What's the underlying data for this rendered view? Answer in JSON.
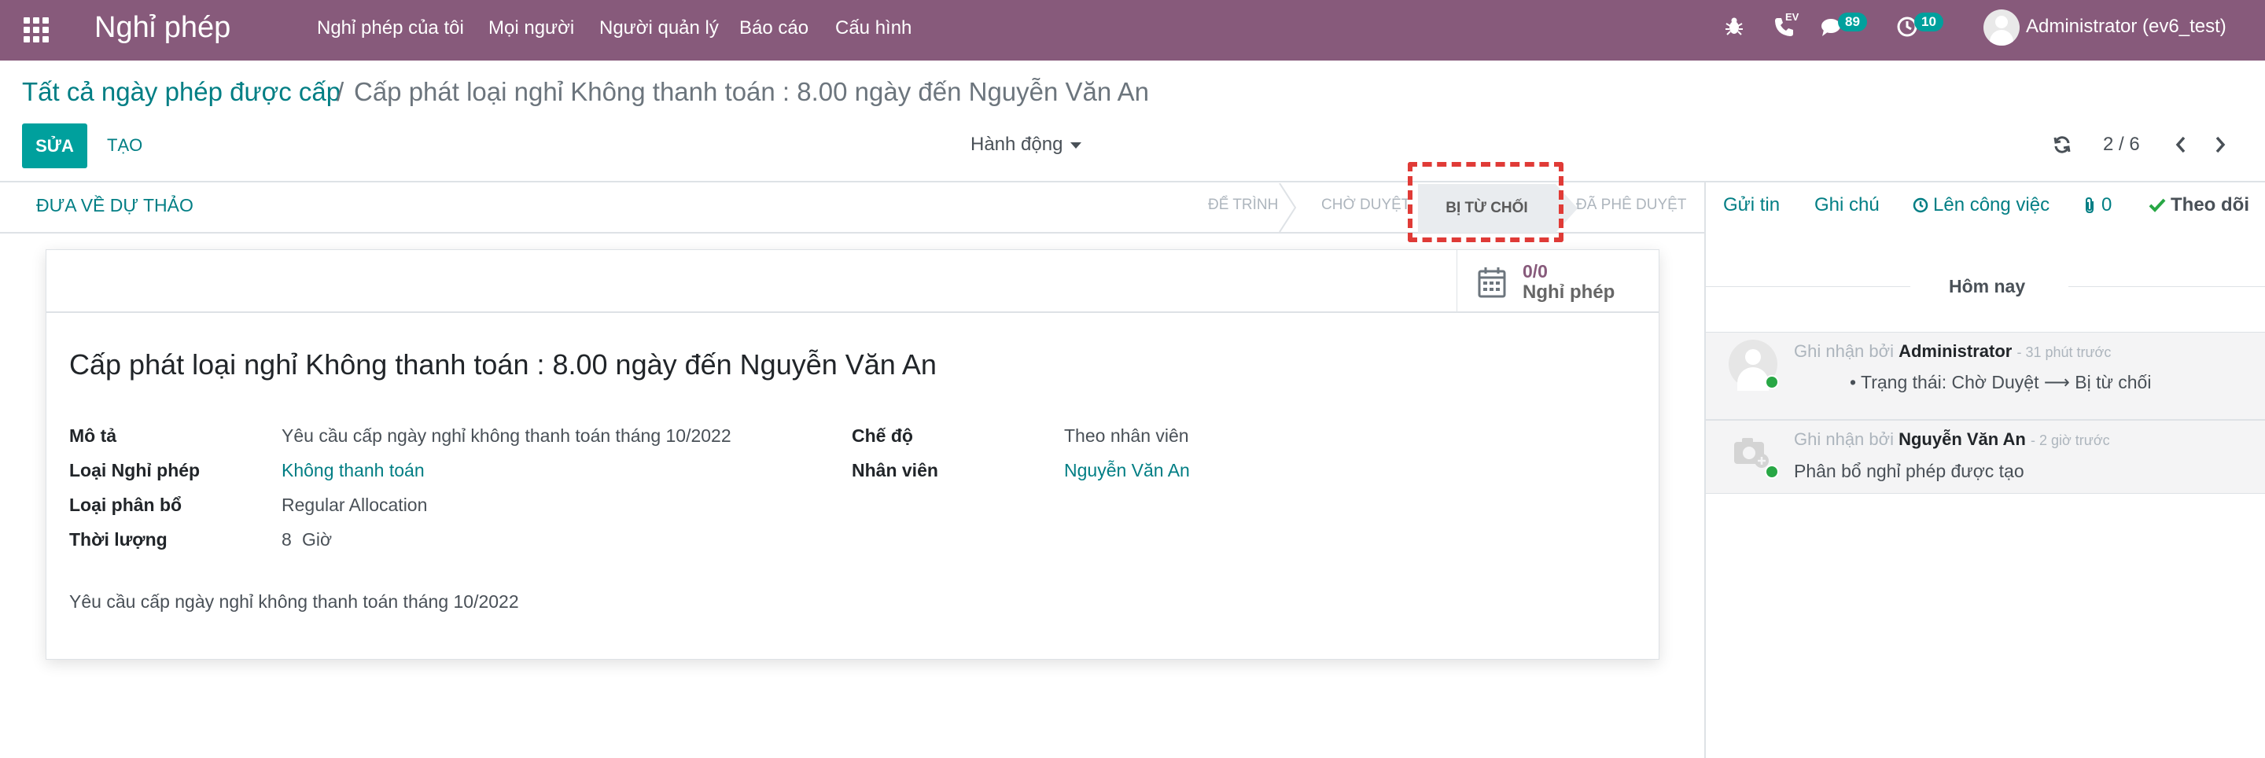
{
  "navbar": {
    "app_title": "Nghỉ phép",
    "menu": [
      "Nghỉ phép của tôi",
      "Mọi người",
      "Người quản lý",
      "Báo cáo",
      "Cấu hình"
    ],
    "phone_label": "EV",
    "messages_count": "89",
    "activities_count": "10",
    "user": "Administrator (ev6_test)"
  },
  "breadcrumb": {
    "parent": "Tất cả ngày phép được cấp",
    "separator": "/",
    "current": "Cấp phát loại nghỉ Không thanh toán : 8.00 ngày đến Nguyễn Văn An"
  },
  "toolbar": {
    "edit_label": "SỬA",
    "create_label": "TẠO",
    "actions_label": "Hành động",
    "pager": "2 / 6"
  },
  "statusbar": {
    "reset_button": "ĐƯA VỀ DỰ THẢO",
    "stages": [
      "ĐỂ TRÌNH",
      "CHỜ DUYỆT",
      "BỊ TỪ CHỐI",
      "ĐÃ PHÊ DUYỆT"
    ],
    "active_stage": "BỊ TỪ CHỐI"
  },
  "smart_button": {
    "value": "0/0",
    "label": "Nghỉ phép"
  },
  "form": {
    "title": "Cấp phát loại nghỉ Không thanh toán : 8.00 ngày đến Nguyễn Văn An",
    "left_fields": [
      {
        "label": "Mô tả",
        "value": "Yêu cầu cấp ngày nghỉ không thanh toán tháng 10/2022"
      },
      {
        "label": "Loại Nghỉ phép",
        "value": "Không thanh toán"
      },
      {
        "label": "Loại phân bổ",
        "value": "Regular Allocation"
      },
      {
        "label": "Thời lượng",
        "value": "8",
        "unit": "Giờ"
      }
    ],
    "right_fields": [
      {
        "label": "Chế độ",
        "value": "Theo nhân viên"
      },
      {
        "label": "Nhân viên",
        "value": "Nguyễn Văn An"
      }
    ],
    "notes": "Yêu cầu cấp ngày nghỉ không thanh toán tháng 10/2022"
  },
  "chatter": {
    "send_message": "Gửi tin",
    "log_note": "Ghi chú",
    "schedule_activity": "Lên công việc",
    "attachments": "0",
    "follow": "Theo dõi",
    "date_separator": "Hôm nay",
    "messages": [
      {
        "prefix": "Ghi nhận bởi",
        "author": "Administrator",
        "time": "- 31 phút trước",
        "tracking": "Trạng thái: Chờ Duyệt ⟶ Bị từ chối"
      },
      {
        "prefix": "Ghi nhận bởi",
        "author": "Nguyễn Văn An",
        "time": "- 2 giờ trước",
        "body": "Phân bổ nghỉ phép được tạo"
      }
    ]
  },
  "colors": {
    "navbar": "#875a7b",
    "primary": "#00a09d",
    "link": "#017e84",
    "highlight": "#e03b37"
  }
}
